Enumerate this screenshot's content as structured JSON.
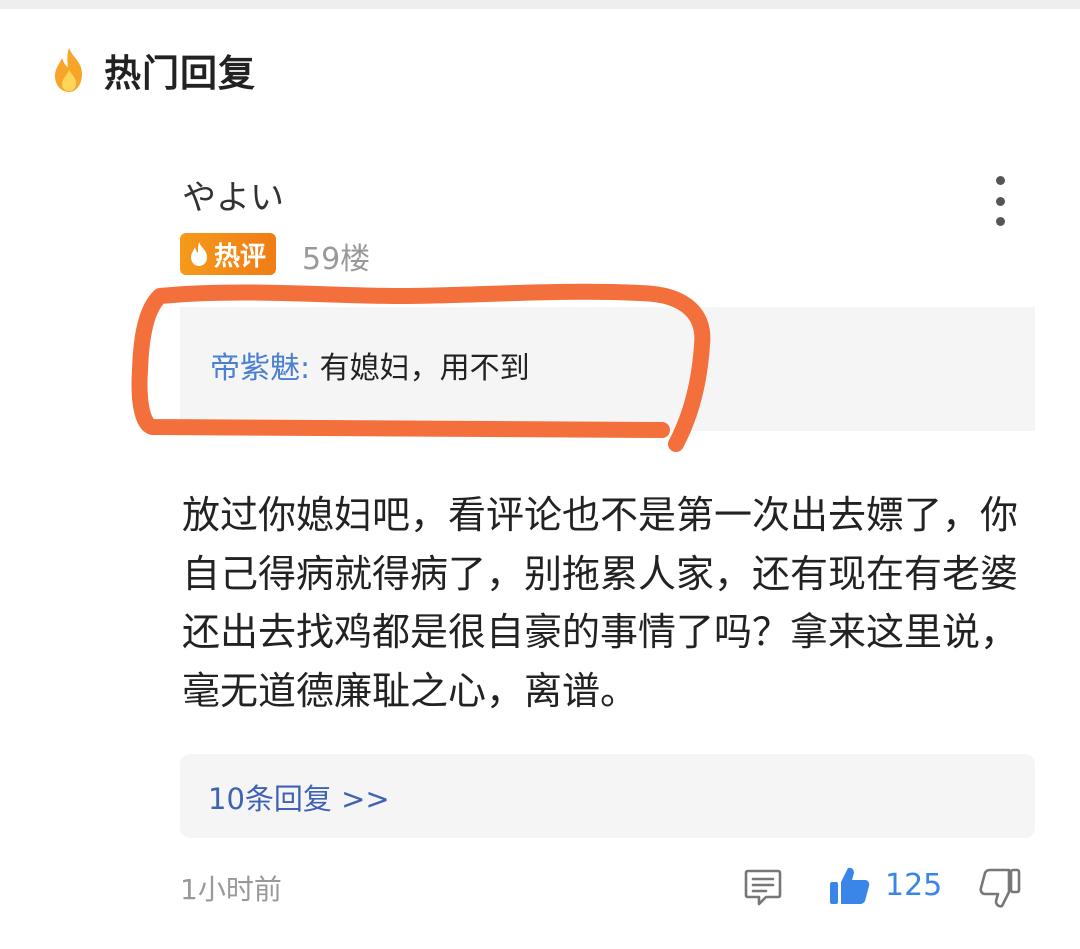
{
  "section": {
    "title": "热门回复",
    "icon": "fire-icon"
  },
  "comment": {
    "username": "やよい",
    "badge": "热评",
    "floor": "59楼",
    "quote": {
      "author": "帝紫魅:",
      "text": " 有媳妇，用不到"
    },
    "body": "放过你媳妇吧，看评论也不是第一次出去嫖了，你自己得病就得病了，别拖累人家，还有现在有老婆还出去找鸡都是很自豪的事情了吗？拿来这里说，毫无道德廉耻之心，离谱。",
    "replies_link": "10条回复 >>",
    "timestamp": "1小时前",
    "likes": "125"
  },
  "colors": {
    "badge": "#f07c16",
    "quote_author": "#4a7fd1",
    "link": "#3f62b5",
    "like": "#3a86e8",
    "annotation": "#f36f3b"
  }
}
